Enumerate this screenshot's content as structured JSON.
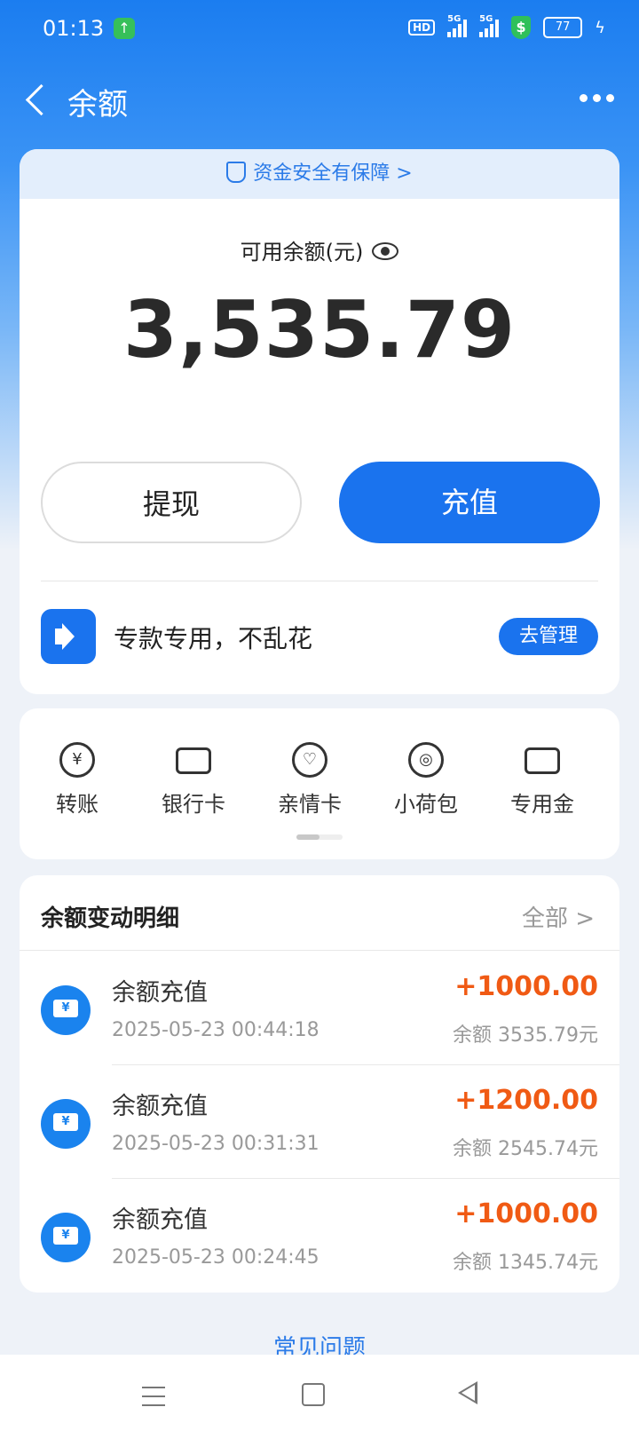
{
  "status_bar": {
    "time": "01:13",
    "hd_label": "HD",
    "signal_1_label": "5G",
    "signal_2_label": "5G",
    "battery": "77"
  },
  "header": {
    "title": "余额"
  },
  "balance_card": {
    "safety_banner": "资金安全有保障 >",
    "available_label": "可用余额(元)",
    "amount": "3,535.79",
    "withdraw_label": "提现",
    "recharge_label": "充值",
    "notice_text": "专款专用，不乱花",
    "manage_label": "去管理"
  },
  "quick_actions": [
    {
      "label": "转账",
      "icon": "yuan-transfer-icon"
    },
    {
      "label": "银行卡",
      "icon": "bank-card-icon"
    },
    {
      "label": "亲情卡",
      "icon": "heart-card-icon"
    },
    {
      "label": "小荷包",
      "icon": "purse-icon"
    },
    {
      "label": "专用金",
      "icon": "wallet-icon"
    }
  ],
  "details": {
    "title": "余额变动明细",
    "all_label": "全部 >",
    "rows": [
      {
        "name": "余额充值",
        "time": "2025-05-23 00:44:18",
        "amount": "+1000.00",
        "balance": "余额 3535.79元"
      },
      {
        "name": "余额充值",
        "time": "2025-05-23 00:31:31",
        "amount": "+1200.00",
        "balance": "余额 2545.74元"
      },
      {
        "name": "余额充值",
        "time": "2025-05-23 00:24:45",
        "amount": "+1000.00",
        "balance": "余额 1345.74元"
      }
    ]
  },
  "faq_label": "常见问题",
  "colors": {
    "primary": "#1a73ee",
    "amount_positive": "#f05a14"
  }
}
